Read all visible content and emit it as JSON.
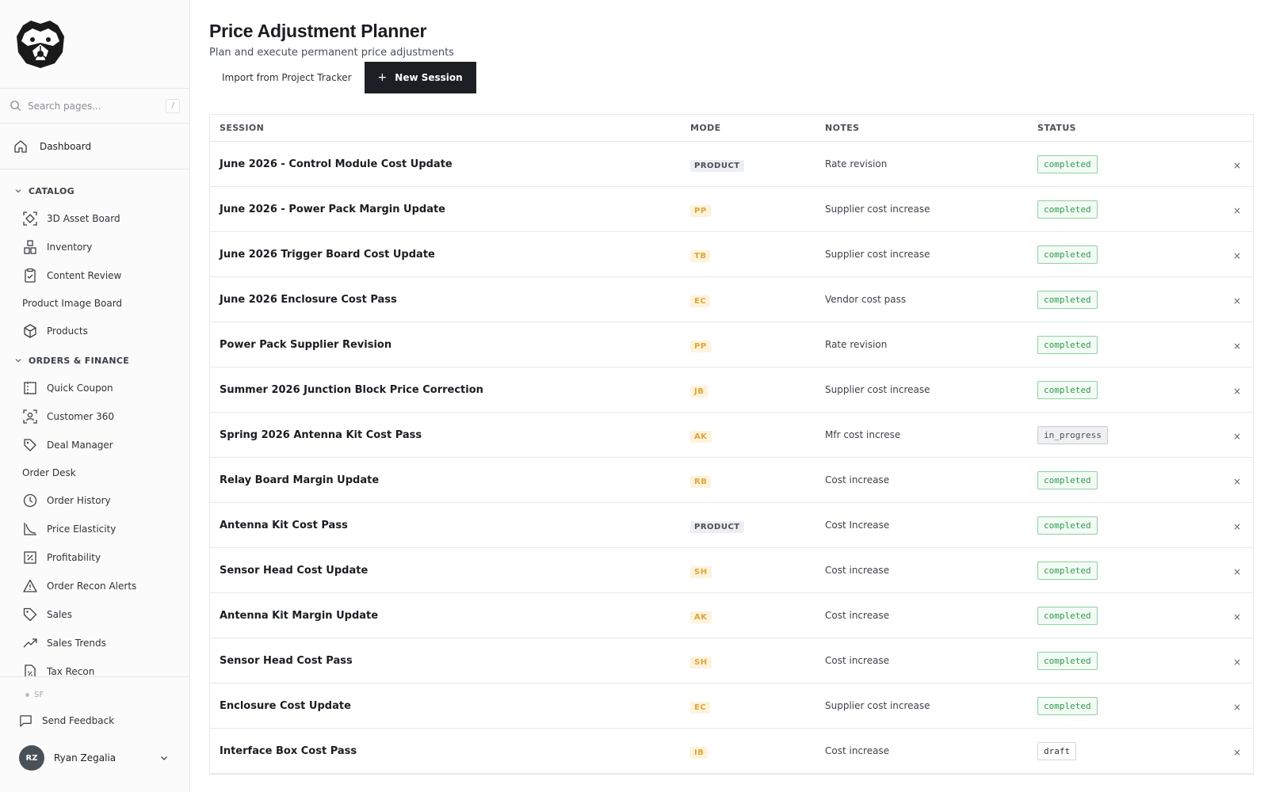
{
  "sidebar": {
    "search_placeholder": "Search pages...",
    "search_shortcut": "/",
    "dashboard": "Dashboard",
    "sections": [
      {
        "title": "CATALOG",
        "items": [
          {
            "label": "3D Asset Board",
            "icon": "scan-icon"
          },
          {
            "label": "Inventory",
            "icon": "boxes-icon"
          },
          {
            "label": "Content Review",
            "icon": "clipboard-check-icon"
          },
          {
            "label": "Product Image Board",
            "icon": ""
          },
          {
            "label": "Products",
            "icon": "package-icon"
          }
        ]
      },
      {
        "title": "ORDERS & FINANCE",
        "items": [
          {
            "label": "Quick Coupon",
            "icon": "ticket-icon"
          },
          {
            "label": "Customer 360",
            "icon": "user-scan-icon"
          },
          {
            "label": "Deal Manager",
            "icon": "tags-icon"
          },
          {
            "label": "Order Desk",
            "icon": ""
          },
          {
            "label": "Order History",
            "icon": "clock-icon"
          },
          {
            "label": "Price Elasticity",
            "icon": "curve-icon"
          },
          {
            "label": "Profitability",
            "icon": "percent-icon"
          },
          {
            "label": "Order Recon Alerts",
            "icon": "alert-triangle-icon"
          },
          {
            "label": "Sales",
            "icon": "tag-icon"
          },
          {
            "label": "Sales Trends",
            "icon": "trending-up-icon"
          },
          {
            "label": "Tax Recon",
            "icon": "file-percent-icon"
          }
        ]
      }
    ],
    "env_label": "SF",
    "feedback": "Send Feedback",
    "user": {
      "initials": "RZ",
      "name": "Ryan Zegalia"
    }
  },
  "header": {
    "title": "Price Adjustment Planner",
    "subtitle": "Plan and execute permanent price adjustments",
    "import_label": "Import from Project Tracker",
    "new_session_label": "New Session"
  },
  "table": {
    "columns": [
      "SESSION",
      "MODE",
      "NOTES",
      "STATUS"
    ],
    "rows": [
      {
        "session": "June 2026 - Control Module Cost Update",
        "mode": "PRODUCT",
        "notes": "Rate revision",
        "status": "completed"
      },
      {
        "session": "June 2026 - Power Pack Margin Update",
        "mode": "PP",
        "notes": "Supplier cost increase",
        "status": "completed"
      },
      {
        "session": "June 2026 Trigger Board Cost Update",
        "mode": "TB",
        "notes": "Supplier cost increase",
        "status": "completed"
      },
      {
        "session": "June 2026 Enclosure Cost Pass",
        "mode": "EC",
        "notes": "Vendor cost pass",
        "status": "completed"
      },
      {
        "session": "Power Pack Supplier Revision",
        "mode": "PP",
        "notes": "Rate revision",
        "status": "completed"
      },
      {
        "session": "Summer 2026 Junction Block Price Correction",
        "mode": "JB",
        "notes": "Supplier cost increase",
        "status": "completed"
      },
      {
        "session": "Spring 2026 Antenna Kit Cost Pass",
        "mode": "AK",
        "notes": "Mfr cost increse",
        "status": "in_progress"
      },
      {
        "session": "Relay Board Margin Update",
        "mode": "RB",
        "notes": "Cost increase",
        "status": "completed"
      },
      {
        "session": "Antenna Kit Cost Pass",
        "mode": "PRODUCT",
        "notes": "Cost Increase",
        "status": "completed"
      },
      {
        "session": "Sensor Head Cost Update",
        "mode": "SH",
        "notes": "Cost increase",
        "status": "completed"
      },
      {
        "session": "Antenna Kit Margin Update",
        "mode": "AK",
        "notes": "Cost increase",
        "status": "completed"
      },
      {
        "session": "Sensor Head Cost Pass",
        "mode": "SH",
        "notes": "Cost increase",
        "status": "completed"
      },
      {
        "session": "Enclosure Cost Update",
        "mode": "EC",
        "notes": "Supplier cost increase",
        "status": "completed"
      },
      {
        "session": "Interface Box Cost Pass",
        "mode": "IB",
        "notes": "Cost increase",
        "status": "draft"
      }
    ],
    "delete_glyph": "×"
  }
}
